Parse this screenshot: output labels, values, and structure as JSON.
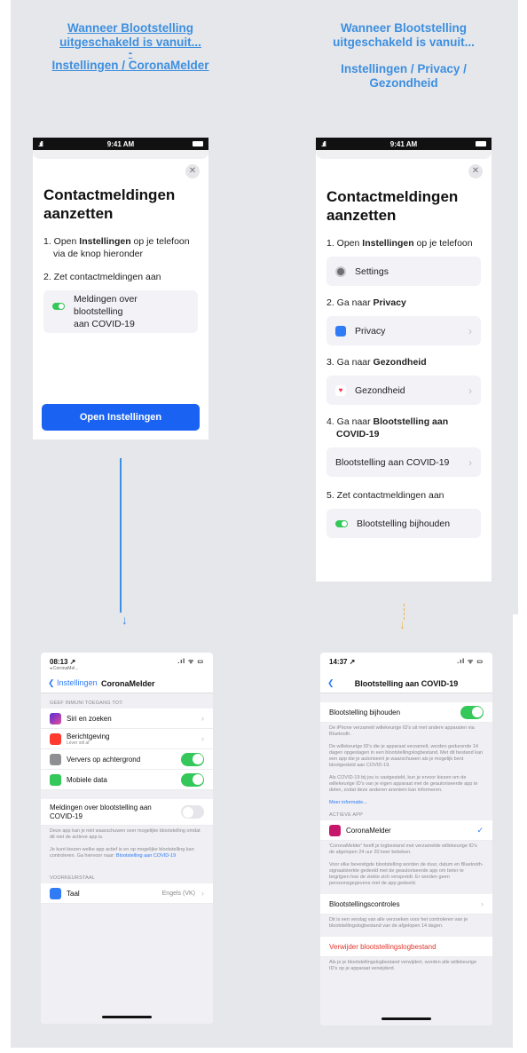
{
  "left_heading": {
    "line1": "Wanneer Blootstelling",
    "line2": "uitgeschakeld is vanuit...",
    "dash": "-",
    "line3": "Instellingen / CoronaMelder"
  },
  "right_heading": {
    "line1": "Wanneer Blootstelling",
    "line2": "uitgeschakeld is vanuit...",
    "line3": "Instellingen / Privacy /",
    "line4": "Gezondheid"
  },
  "status": {
    "time": "9:41 AM"
  },
  "sheet_left": {
    "title_line1": "Contactmeldingen",
    "title_line2": "aanzetten",
    "step1_pre": "1. Open ",
    "step1_bold": "Instellingen",
    "step1_post": " op je telefoon",
    "step1_line2": "via de knop hieronder",
    "step2": "2. Zet contactmeldingen aan",
    "toggle_line1": "Meldingen over blootstelling",
    "toggle_line2": "aan COVID-19",
    "button": "Open Instellingen",
    "close": "✕"
  },
  "sheet_right": {
    "title_line1": "Contactmeldingen",
    "title_line2": "aanzetten",
    "step1_pre": "1. Open ",
    "step1_bold": "Instellingen",
    "step1_post": " op je telefoon",
    "settings_label": "Settings",
    "step2_pre": "2. Ga naar ",
    "step2_bold": "Privacy",
    "privacy_label": "Privacy",
    "step3_pre": "3. Ga naar ",
    "step3_bold": "Gezondheid",
    "health_label": "Gezondheid",
    "step4_pre": "4. Ga naar ",
    "step4_bold_line1": "Blootstelling aan",
    "step4_bold_line2": "COVID-19",
    "exposure_label": "Blootstelling aan COVID-19",
    "step5": "5. Zet contactmeldingen aan",
    "toggle_label": "Blootstelling bijhouden",
    "close": "✕"
  },
  "screen_left": {
    "time": "08:13 ↗",
    "sub": "◂ CoronaMel...",
    "indicators": ".ıl ᯤ ▭",
    "back_label": "❮ Instellingen",
    "title": "CoronaMelder",
    "section1": "GEEF INMUNI TOEGANG TOT:",
    "rows": [
      {
        "label": "Siri en zoeken",
        "sub": ""
      },
      {
        "label": "Berichtgeving",
        "sub": "Lever stil af"
      },
      {
        "label": "Ververs op achtergrond",
        "sub": ""
      },
      {
        "label": "Mobiele data",
        "sub": ""
      }
    ],
    "exposure_line1": "Meldingen over blootstelling aan",
    "exposure_line2": "COVID-19",
    "note1": "Deze app kan je niet waarschuwen over mogelijke blootstelling omdat dit niet de actieve app is.",
    "note2_pre": "Je kunt kiezen welke app actief is en op mogelijke blootstelling kan controleren. Ga hiervoor naar: ",
    "note2_link": "Blootstelling aan COVID-19",
    "section2": "VOORKEURSTAAL",
    "language_label": "Taal",
    "language_value": "Engels (VK)"
  },
  "screen_right": {
    "time": "14:37 ↗",
    "indicators": ".ıl ᯤ ▭",
    "back_label": "❮",
    "title": "Blootstelling aan COVID-19",
    "tracking_label": "Blootstelling bijhouden",
    "note1": "De iPhone verzamelt willekeurige ID's uit met andere apparaten via Bluetooth.",
    "note2": "De willekeurige ID's die je apparaat verzamelt, worden gedurende 14 dagen opgeslagen in een blootstellingslogbestand. Met dit bestand kan een app die je autoriseert je waarschuwen als je mogelijk bent blootgesteld aan COVID-19.",
    "note3": "Als COVID-19 bij jou is vastgesteld, kun je ervoor kiezen om de willekeurige ID's van je eigen apparaat met de geautoriseerde app te delen, zodat deze anderen anoniem kan informeren.",
    "more_info": "Meer informatie...",
    "active_app_hdr": "ACTIEVE APP",
    "app_name": "CoronaMelder",
    "check": "✓",
    "note4": "'CoronaMelder' heeft je logbestand met verzamelde willekeurige ID's de afgelopen 24 uur 20 keer bekeken.",
    "note5": "Voor elke bevestigde blootstelling worden de duur, datum en Bluetooth-signaalsterkte gedeeld met de geautoriseerde app om beter te begrijpen hoe de ziekte zich verspreidt. Er worden geen persoonsgegevens met de app gedeeld.",
    "checks_label": "Blootstellingscontroles",
    "note6": "Dit is een verslag van alle verzoeken voor het controleren van je blootstellingslogbestand van de afgelopen 14 dagen.",
    "delete_label": "Verwijder blootstellingslogbestand",
    "note7": "Als je je blootstellingslogbestand verwijdert, worden alle willekeurige ID's op je apparaat verwijderd."
  },
  "arrows": {
    "down": "↓"
  },
  "colors": {
    "accent": "#3d8fe0",
    "button_blue": "#1a63f2",
    "toggle_green": "#34c759",
    "dashed_orange": "#f0b24a",
    "destructive_red": "#e0352b"
  }
}
